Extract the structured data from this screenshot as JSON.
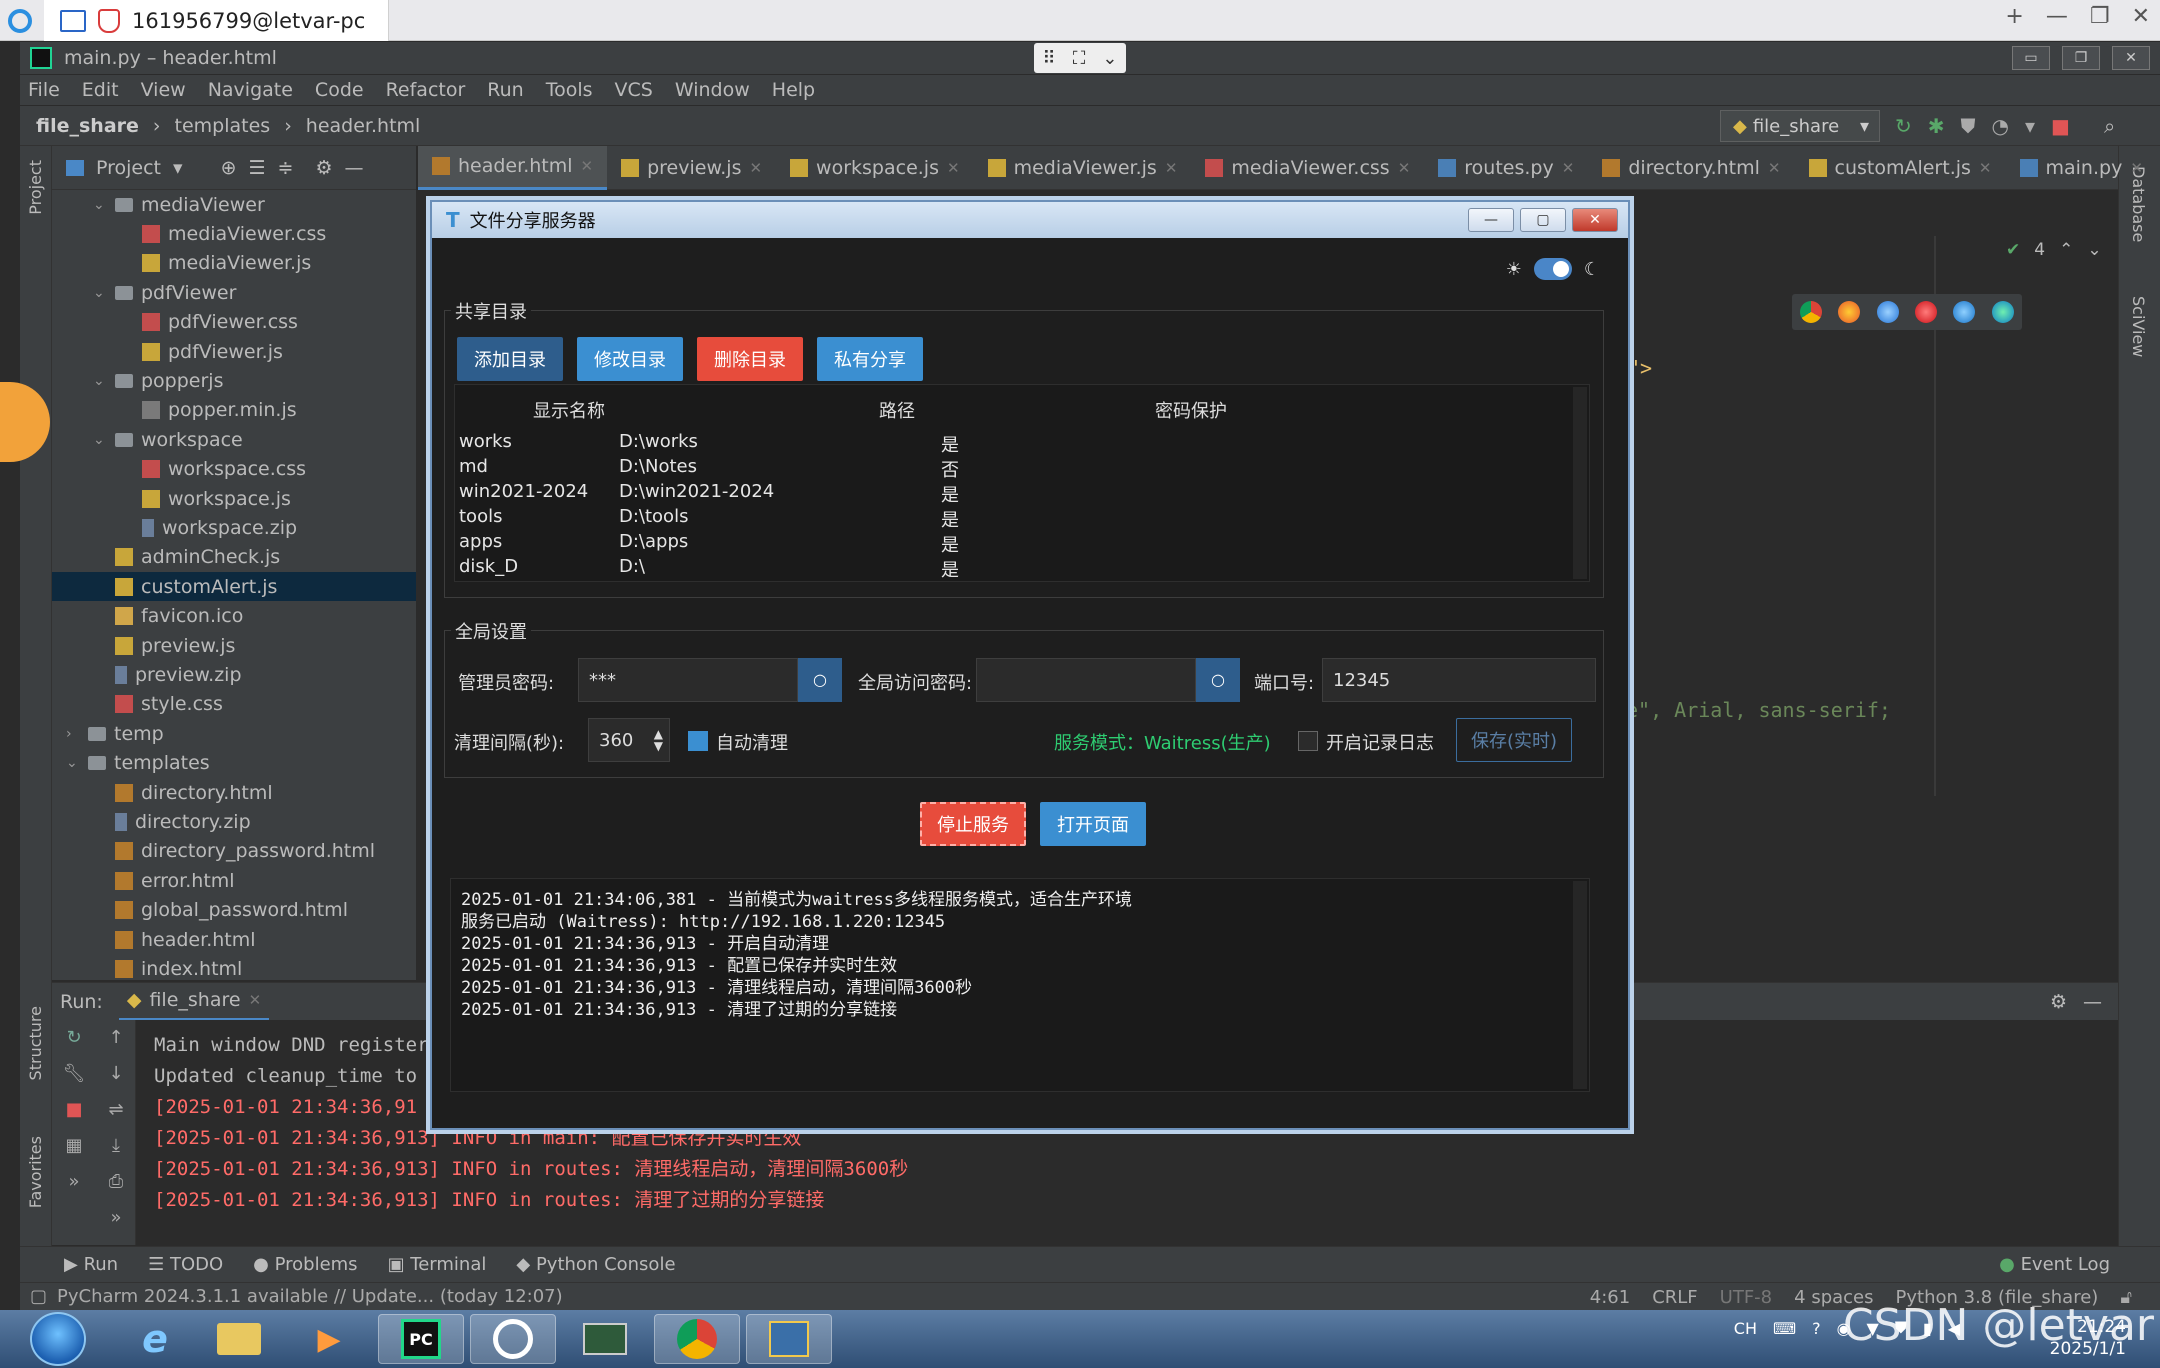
{
  "remote": {
    "session_title": "161956799@letvar-pc",
    "controls": [
      "+",
      "—",
      "❐",
      "✕"
    ]
  },
  "ide": {
    "window_title": "main.py – header.html",
    "menu": [
      "File",
      "Edit",
      "View",
      "Navigate",
      "Code",
      "Refactor",
      "Run",
      "Tools",
      "VCS",
      "Window",
      "Help"
    ],
    "breadcrumb": [
      "file_share",
      "templates",
      "header.html"
    ],
    "run_config": "file_share",
    "project_header": "Project",
    "tree": [
      {
        "label": "mediaViewer",
        "type": "folder",
        "level": 1,
        "expanded": true
      },
      {
        "label": "mediaViewer.css",
        "type": "css",
        "level": 2
      },
      {
        "label": "mediaViewer.js",
        "type": "js",
        "level": 2
      },
      {
        "label": "pdfViewer",
        "type": "folder",
        "level": 1,
        "expanded": true
      },
      {
        "label": "pdfViewer.css",
        "type": "css",
        "level": 2
      },
      {
        "label": "pdfViewer.js",
        "type": "js",
        "level": 2
      },
      {
        "label": "popperjs",
        "type": "folder",
        "level": 1,
        "expanded": true
      },
      {
        "label": "popper.min.js",
        "type": "min",
        "level": 2
      },
      {
        "label": "workspace",
        "type": "folder",
        "level": 1,
        "expanded": true
      },
      {
        "label": "workspace.css",
        "type": "css",
        "level": 2
      },
      {
        "label": "workspace.js",
        "type": "js",
        "level": 2
      },
      {
        "label": "workspace.zip",
        "type": "zip",
        "level": 2
      },
      {
        "label": "adminCheck.js",
        "type": "js",
        "level": 1
      },
      {
        "label": "customAlert.js",
        "type": "js",
        "level": 1,
        "selected": true
      },
      {
        "label": "favicon.ico",
        "type": "ico",
        "level": 1
      },
      {
        "label": "preview.js",
        "type": "js",
        "level": 1
      },
      {
        "label": "preview.zip",
        "type": "zip",
        "level": 1
      },
      {
        "label": "style.css",
        "type": "css",
        "level": 1
      },
      {
        "label": "temp",
        "type": "folder",
        "level": 0,
        "expanded": false
      },
      {
        "label": "templates",
        "type": "folder",
        "level": 0,
        "expanded": true
      },
      {
        "label": "directory.html",
        "type": "html",
        "level": 1
      },
      {
        "label": "directory.zip",
        "type": "zip",
        "level": 1
      },
      {
        "label": "directory_password.html",
        "type": "html",
        "level": 1
      },
      {
        "label": "error.html",
        "type": "html",
        "level": 1
      },
      {
        "label": "global_password.html",
        "type": "html",
        "level": 1
      },
      {
        "label": "header.html",
        "type": "html",
        "level": 1
      },
      {
        "label": "index.html",
        "type": "html",
        "level": 1
      }
    ],
    "tabs": [
      {
        "label": "header.html",
        "type": "html",
        "active": true
      },
      {
        "label": "preview.js",
        "type": "js"
      },
      {
        "label": "workspace.js",
        "type": "js"
      },
      {
        "label": "mediaViewer.js",
        "type": "js"
      },
      {
        "label": "mediaViewer.css",
        "type": "css"
      },
      {
        "label": "routes.py",
        "type": "py"
      },
      {
        "label": "directory.html",
        "type": "html"
      },
      {
        "label": "customAlert.js",
        "type": "js"
      },
      {
        "label": "main.py",
        "type": "py"
      }
    ],
    "inspection_count": "4",
    "code_fragment_1": "\">",
    "code_fragment_2": "e\", Arial, sans-serif;",
    "side_labels": {
      "project": "Project",
      "structure": "Structure",
      "favorites": "Favorites",
      "database": "Database",
      "sciview": "SciView"
    },
    "run": {
      "label": "Run:",
      "tab": "file_share",
      "console": [
        {
          "text": "Main window DND register",
          "kind": "std"
        },
        {
          "text": "Updated cleanup_time to",
          "kind": "std"
        },
        {
          "text": "[2025-01-01 21:34:36,91",
          "kind": "err"
        },
        {
          "text": "[2025-01-01 21:34:36,913] INFO in main: 配置已保存并实时生效",
          "kind": "err"
        },
        {
          "text": "[2025-01-01 21:34:36,913] INFO in routes: 清理线程启动，清理间隔3600秒",
          "kind": "err"
        },
        {
          "text": "[2025-01-01 21:34:36,913] INFO in routes: 清理了过期的分享链接",
          "kind": "err"
        }
      ]
    },
    "tool_tabs": [
      "Run",
      "TODO",
      "Problems",
      "Terminal",
      "Python Console"
    ],
    "event_log": "Event Log",
    "status": {
      "message": "PyCharm 2024.3.1.1 available // Update... (today 12:07)",
      "position": "4:61",
      "line_sep": "CRLF",
      "encoding": "UTF-8",
      "indent": "4 spaces",
      "interpreter": "Python 3.8 (file_share)"
    }
  },
  "dialog": {
    "title": "文件分享服务器",
    "theme": {
      "sun": "☀",
      "moon": "☾",
      "dark_mode": true
    },
    "share_group": {
      "title": "共享目录",
      "buttons": {
        "add": "添加目录",
        "edit": "修改目录",
        "delete": "删除目录",
        "private": "私有分享"
      },
      "headers": {
        "name": "显示名称",
        "path": "路径",
        "password": "密码保护"
      },
      "rows": [
        {
          "name": "works",
          "path": "D:\\works",
          "pw": "是"
        },
        {
          "name": "md",
          "path": "D:\\Notes",
          "pw": "否"
        },
        {
          "name": "win2021-2024",
          "path": "D:\\win2021-2024",
          "pw": "是"
        },
        {
          "name": "tools",
          "path": "D:\\tools",
          "pw": "是"
        },
        {
          "name": "apps",
          "path": "D:\\apps",
          "pw": "是"
        },
        {
          "name": "disk_D",
          "path": "D:\\",
          "pw": "是"
        }
      ]
    },
    "global_group": {
      "title": "全局设置",
      "admin_pw_label": "管理员密码:",
      "admin_pw_value": "***",
      "global_pw_label": "全局访问密码:",
      "global_pw_value": "",
      "port_label": "端口号:",
      "port_value": "12345",
      "cleanup_label": "清理间隔(秒):",
      "cleanup_value": "360",
      "auto_clean_label": "自动清理",
      "auto_clean": true,
      "mode_text": "服务模式：Waitress(生产)",
      "log_label": "开启记录日志",
      "log_enabled": false,
      "save_label": "保存(实时)"
    },
    "stop_label": "停止服务",
    "open_label": "打开页面",
    "log": [
      "2025-01-01 21:34:06,381 - 当前模式为waitress多线程服务模式，适合生产环境",
      "服务已启动 (Waitress): http://192.168.1.220:12345",
      "2025-01-01 21:34:36,913 - 开启自动清理",
      "2025-01-01 21:34:36,913 - 配置已保存并实时生效",
      "2025-01-01 21:34:36,913 - 清理线程启动，清理间隔3600秒",
      "2025-01-01 21:34:36,913 - 清理了过期的分享链接"
    ]
  },
  "taskbar": {
    "clock_time": "21:24",
    "clock_date": "2025/1/1",
    "lang": "CH",
    "watermark": "CSDN @letvar"
  },
  "colors": {
    "accent": "#4a88c7",
    "danger": "#e74c3c",
    "primary": "#3b8fd1",
    "mode_text": "#2ecc71",
    "console_err": "#ff6b68"
  }
}
